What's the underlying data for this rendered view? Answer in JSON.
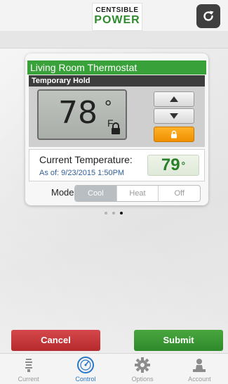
{
  "header": {
    "logo_line1": "CENTSIBLE",
    "logo_line2": "POWER"
  },
  "thermostat": {
    "name": "Living Room Thermostat",
    "hold_status": "Temporary Hold",
    "setpoint": "78",
    "setpoint_degree": "°",
    "unit": "F",
    "current_label": "Current Temperature:",
    "as_of": "As of: 9/23/2015 1:50PM",
    "current_temp": "79",
    "current_degree": "°",
    "mode_label": "Mode:",
    "modes": [
      "Cool",
      "Heat",
      "Off"
    ],
    "selected_mode": "Cool"
  },
  "pager": {
    "pages": 3,
    "active_index": 2
  },
  "actions": {
    "cancel_label": "Cancel",
    "submit_label": "Submit"
  },
  "tabs": [
    {
      "label": "Current",
      "icon": "bulb-icon"
    },
    {
      "label": "Control",
      "icon": "dial-icon"
    },
    {
      "label": "Options",
      "icon": "gear-icon"
    },
    {
      "label": "Account",
      "icon": "person-icon"
    }
  ],
  "active_tab": "Control",
  "colors": {
    "brand_green": "#39a13a",
    "cancel_red": "#c3383b",
    "lock_orange": "#f7a11a",
    "tab_active_blue": "#2b78c6"
  }
}
